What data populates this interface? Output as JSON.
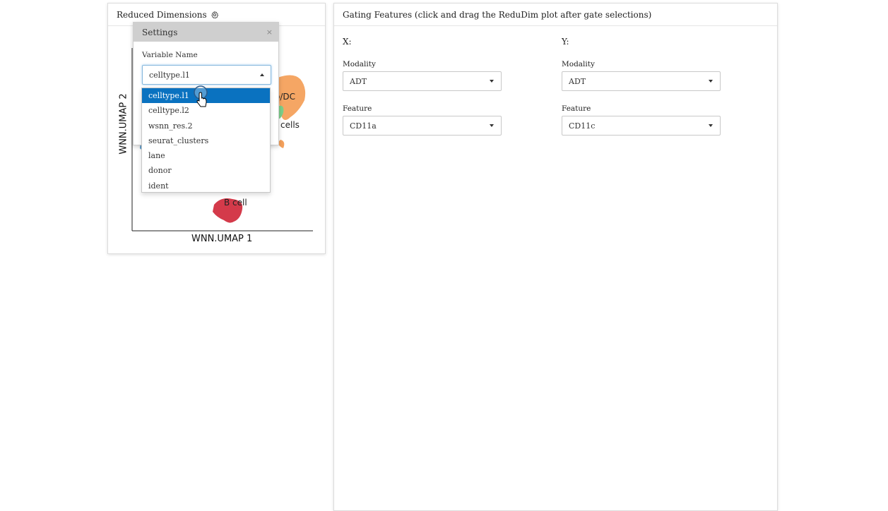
{
  "left_panel": {
    "title": "Reduced Dimensions",
    "gear_icon": "gear-icon",
    "plot": {
      "xlabel": "WNN.UMAP 1",
      "ylabel": "WNN.UMAP 2",
      "cluster_labels": [
        "o/DC",
        "cells",
        "B cell"
      ],
      "colors": {
        "b_cell": "#d43a4a",
        "mono_dc": "#f4a15c",
        "other": "#7ccf8a",
        "blue": "#5a9fd4"
      }
    },
    "settings": {
      "title": "Settings",
      "close_label": "×",
      "variable_label": "Variable Name",
      "variable_value": "celltype.l1",
      "options": [
        "celltype.l1",
        "celltype.l2",
        "wsnn_res.2",
        "seurat_clusters",
        "lane",
        "donor",
        "ident"
      ],
      "selected_index": 0
    }
  },
  "right_panel": {
    "title": "Gating Features (click and drag the ReduDim plot after gate selections)",
    "x": {
      "axis_title": "X:",
      "modality_label": "Modality",
      "modality_value": "ADT",
      "feature_label": "Feature",
      "feature_value": "CD11a"
    },
    "y": {
      "axis_title": "Y:",
      "modality_label": "Modality",
      "modality_value": "ADT",
      "feature_label": "Feature",
      "feature_value": "CD11c"
    }
  }
}
